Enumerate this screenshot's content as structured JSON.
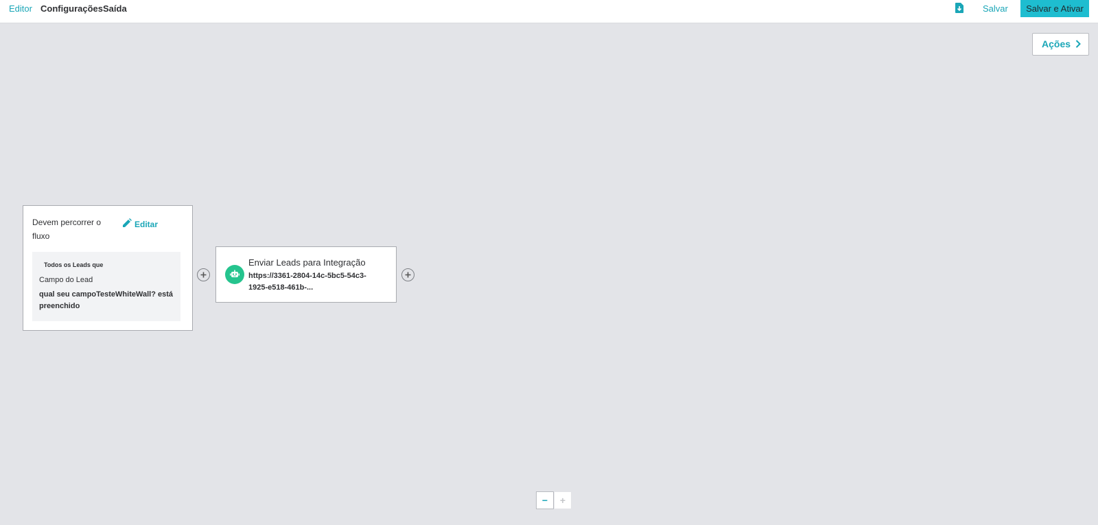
{
  "header": {
    "tabs": [
      {
        "label": "Editor"
      },
      {
        "label": "Configurações"
      },
      {
        "label": "Saída"
      }
    ],
    "save_label": "Salvar",
    "save_activate_label": "Salvar e Ativar",
    "accent_color": "#1aa6b7"
  },
  "actions_button": {
    "label": "Ações"
  },
  "start_node": {
    "title": "Devem percorrer o fluxo",
    "edit_label": "Editar",
    "filter_heading": "Todos os Leads que",
    "filter_field": "Campo do Lead",
    "filter_condition": "qual seu campoTesteWhiteWall? está preenchido"
  },
  "action_node": {
    "title": "Enviar Leads para Integração",
    "url": "https://3361-2804-14c-5bc5-54c3-1925-e518-461b-...",
    "icon": "robot-icon",
    "icon_color": "#25c48e"
  },
  "zoom": {
    "out_label": "−",
    "in_label": "+"
  }
}
